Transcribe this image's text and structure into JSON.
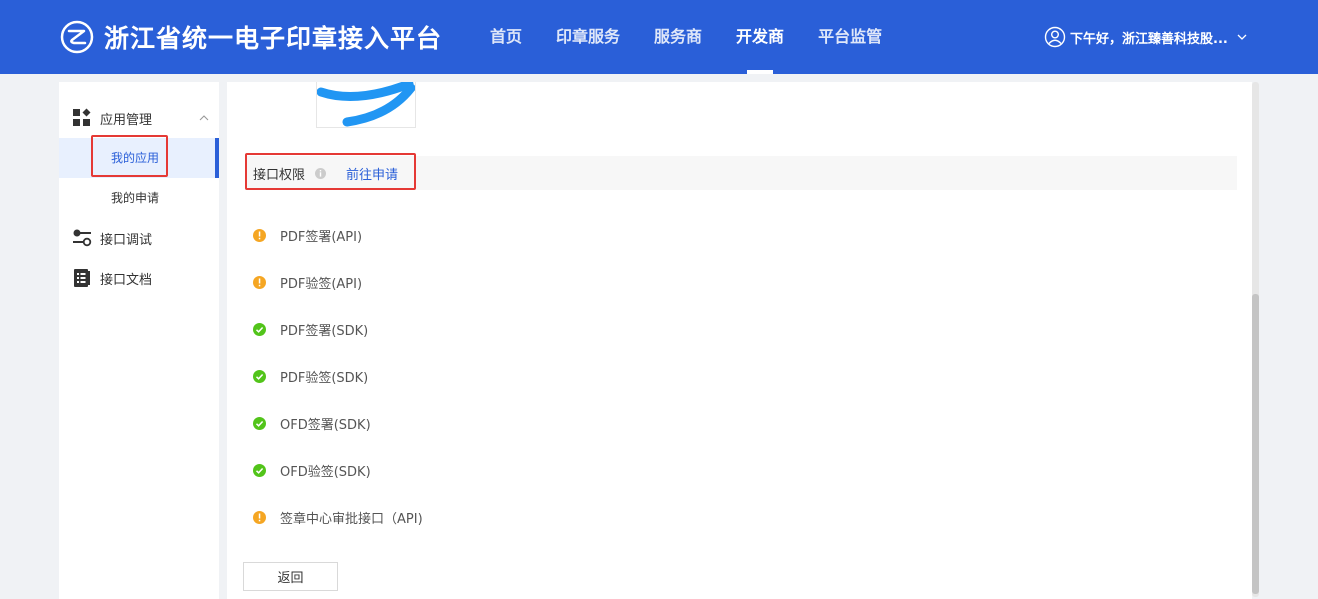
{
  "header": {
    "title": "浙江省统一电子印章接入平台",
    "logo_icon": "platform-logo-icon",
    "nav": [
      {
        "label": "首页",
        "active": false
      },
      {
        "label": "印章服务",
        "active": false
      },
      {
        "label": "服务商",
        "active": false
      },
      {
        "label": "开发商",
        "active": true
      },
      {
        "label": "平台监管",
        "active": false
      }
    ],
    "user_greeting": "下午好，浙江臻善科技股...",
    "brand_color": "#2a5fd8"
  },
  "sidebar": {
    "groups": [
      {
        "label": "应用管理",
        "icon": "app-grid-icon",
        "expanded": true,
        "items": [
          {
            "label": "我的应用",
            "active": true
          },
          {
            "label": "我的申请",
            "active": false
          }
        ]
      },
      {
        "label": "接口调试",
        "icon": "debug-toggle-icon"
      },
      {
        "label": "接口文档",
        "icon": "document-icon"
      }
    ]
  },
  "main": {
    "permissions": {
      "label": "接口权限",
      "apply_link": "前往申请",
      "items": [
        {
          "name": "PDF签署(API)",
          "status": "warning"
        },
        {
          "name": "PDF验签(API)",
          "status": "warning"
        },
        {
          "name": "PDF签署(SDK)",
          "status": "ok"
        },
        {
          "name": "PDF验签(SDK)",
          "status": "ok"
        },
        {
          "name": "OFD签署(SDK)",
          "status": "ok"
        },
        {
          "name": "OFD验签(SDK)",
          "status": "ok"
        },
        {
          "name": "签章中心审批接口（API)",
          "status": "warning"
        }
      ]
    },
    "back_button": "返回"
  },
  "colors": {
    "warning": "#f5a623",
    "ok": "#52c41a",
    "highlight_box": "#e53935"
  }
}
